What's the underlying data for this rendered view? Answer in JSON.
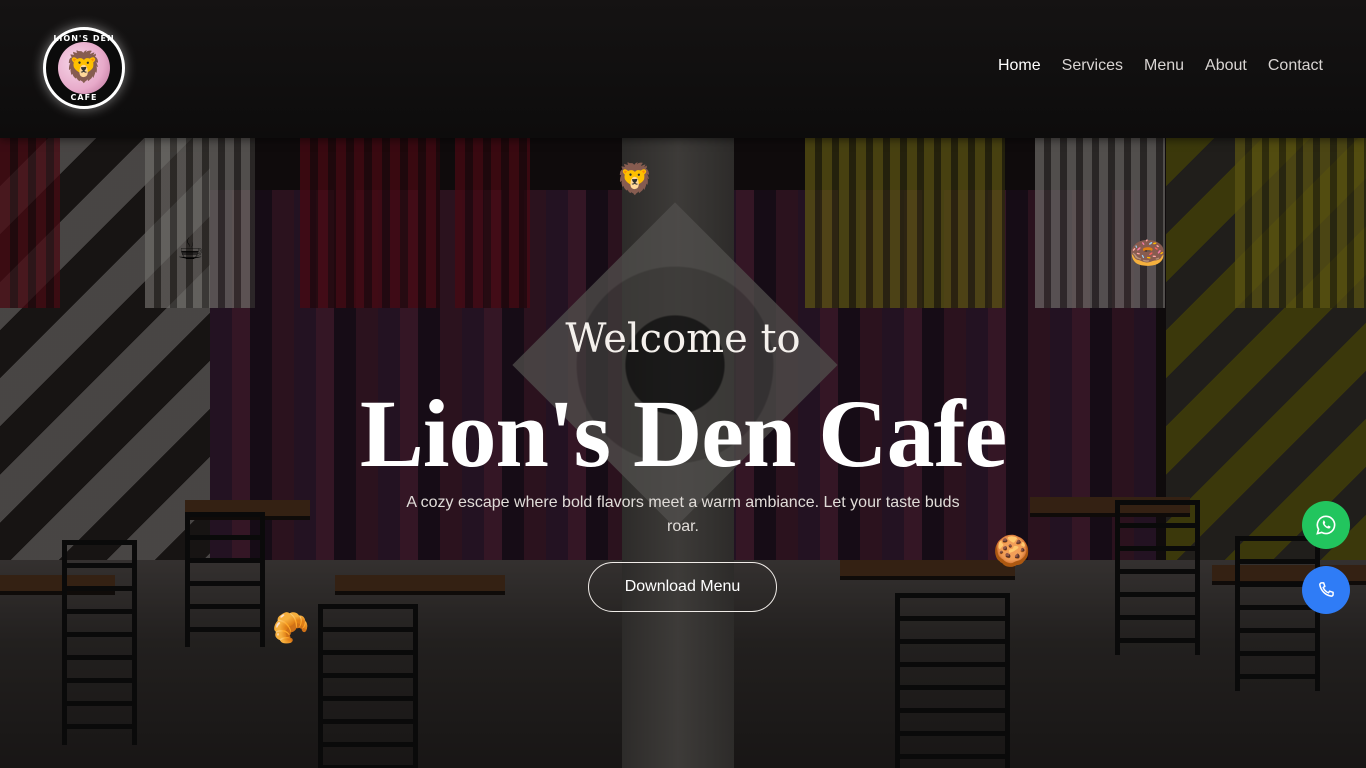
{
  "brand": {
    "logo_text_top": "LION'S DEN",
    "logo_text_bottom": "CAFE",
    "logo_icon": "lion-face-icon"
  },
  "nav": {
    "items": [
      {
        "label": "Home",
        "active": true
      },
      {
        "label": "Services",
        "active": false
      },
      {
        "label": "Menu",
        "active": false
      },
      {
        "label": "About",
        "active": false
      },
      {
        "label": "Contact",
        "active": false
      }
    ]
  },
  "hero": {
    "welcome": "Welcome to",
    "title": "Lion's Den Cafe",
    "subtitle": "A cozy escape where bold flavors meet a warm ambiance. Let your taste buds roar.",
    "cta_label": "Download Menu"
  },
  "floating_emoji": [
    {
      "name": "lion-emoji",
      "glyph": "🦁"
    },
    {
      "name": "coffee-emoji",
      "glyph": "☕"
    },
    {
      "name": "donut-emoji",
      "glyph": "🍩"
    },
    {
      "name": "cookie-emoji",
      "glyph": "🍪"
    },
    {
      "name": "croissant-emoji",
      "glyph": "🥐"
    }
  ],
  "contact_buttons": {
    "whatsapp_icon": "whatsapp-icon",
    "phone_icon": "phone-icon",
    "whatsapp_color": "#22c55e",
    "phone_color": "#2f7cf6"
  }
}
